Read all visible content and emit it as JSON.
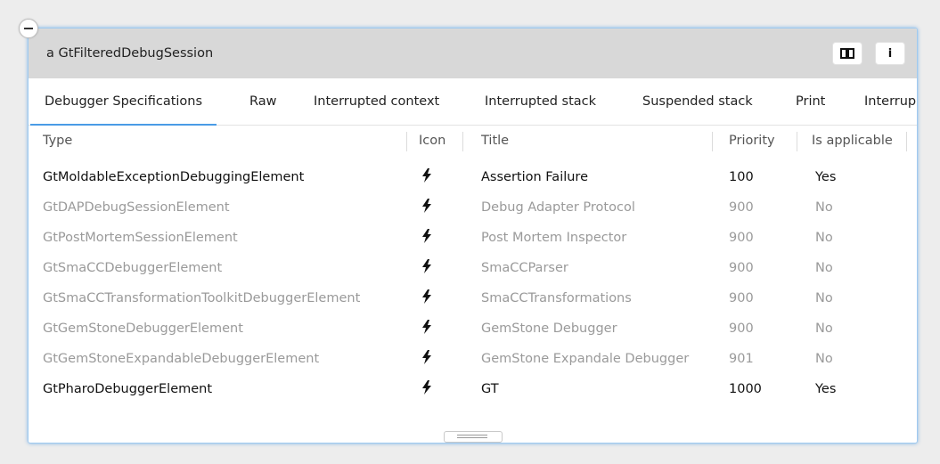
{
  "window": {
    "title": "a GtFilteredDebugSession",
    "book_icon": "book-icon",
    "info_label": "i"
  },
  "tabs": [
    {
      "label": "Debugger Specifications",
      "active": true
    },
    {
      "label": "Raw"
    },
    {
      "label": "Interrupted context"
    },
    {
      "label": "Interrupted stack"
    },
    {
      "label": "Suspended stack"
    },
    {
      "label": "Print"
    },
    {
      "label": "Interrup"
    }
  ],
  "table": {
    "headers": [
      "Type",
      "Icon",
      "Title",
      "Priority",
      "Is applicable"
    ],
    "rows": [
      {
        "type": "GtMoldableExceptionDebuggingElement",
        "icon": "lightning-icon",
        "title": "Assertion Failure",
        "priority": "100",
        "applicable": "Yes"
      },
      {
        "type": "GtDAPDebugSessionElement",
        "icon": "lightning-icon",
        "title": "Debug Adapter Protocol",
        "priority": "900",
        "applicable": "No"
      },
      {
        "type": "GtPostMortemSessionElement",
        "icon": "lightning-icon",
        "title": "Post Mortem Inspector",
        "priority": "900",
        "applicable": "No"
      },
      {
        "type": "GtSmaCCDebuggerElement",
        "icon": "lightning-icon",
        "title": "SmaCCParser",
        "priority": "900",
        "applicable": "No"
      },
      {
        "type": "GtSmaCCTransformationToolkitDebuggerElement",
        "icon": "lightning-icon",
        "title": "SmaCCTransformations",
        "priority": "900",
        "applicable": "No"
      },
      {
        "type": "GtGemStoneDebuggerElement",
        "icon": "lightning-icon",
        "title": "GemStone Debugger",
        "priority": "900",
        "applicable": "No"
      },
      {
        "type": "GtGemStoneExpandableDebuggerElement",
        "icon": "lightning-icon",
        "title": "GemStone Expandale Debugger",
        "priority": "901",
        "applicable": "No"
      },
      {
        "type": "GtPharoDebuggerElement",
        "icon": "lightning-icon",
        "title": "GT",
        "priority": "1000",
        "applicable": "Yes"
      }
    ]
  },
  "colors": {
    "accent": "#4a9be6",
    "applicable_text": "#111111",
    "inapplicable_text": "#9a9a9a"
  }
}
